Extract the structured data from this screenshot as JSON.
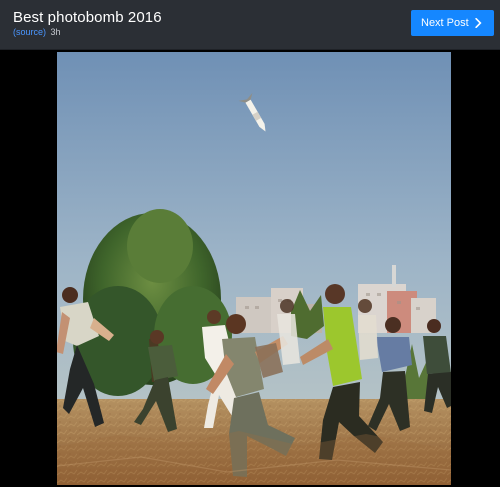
{
  "header": {
    "title": "Best photobomb 2016",
    "source_label": "(source)",
    "time_ago": "3h",
    "next_button_label": "Next Post",
    "next_icon": "chevron-right-icon"
  },
  "viewer": {
    "image_subject": "photo"
  },
  "colors": {
    "header_background": "#2b2f35",
    "accent_blue": "#1587ff",
    "source_link": "#4a96ff",
    "page_background": "#000000"
  }
}
